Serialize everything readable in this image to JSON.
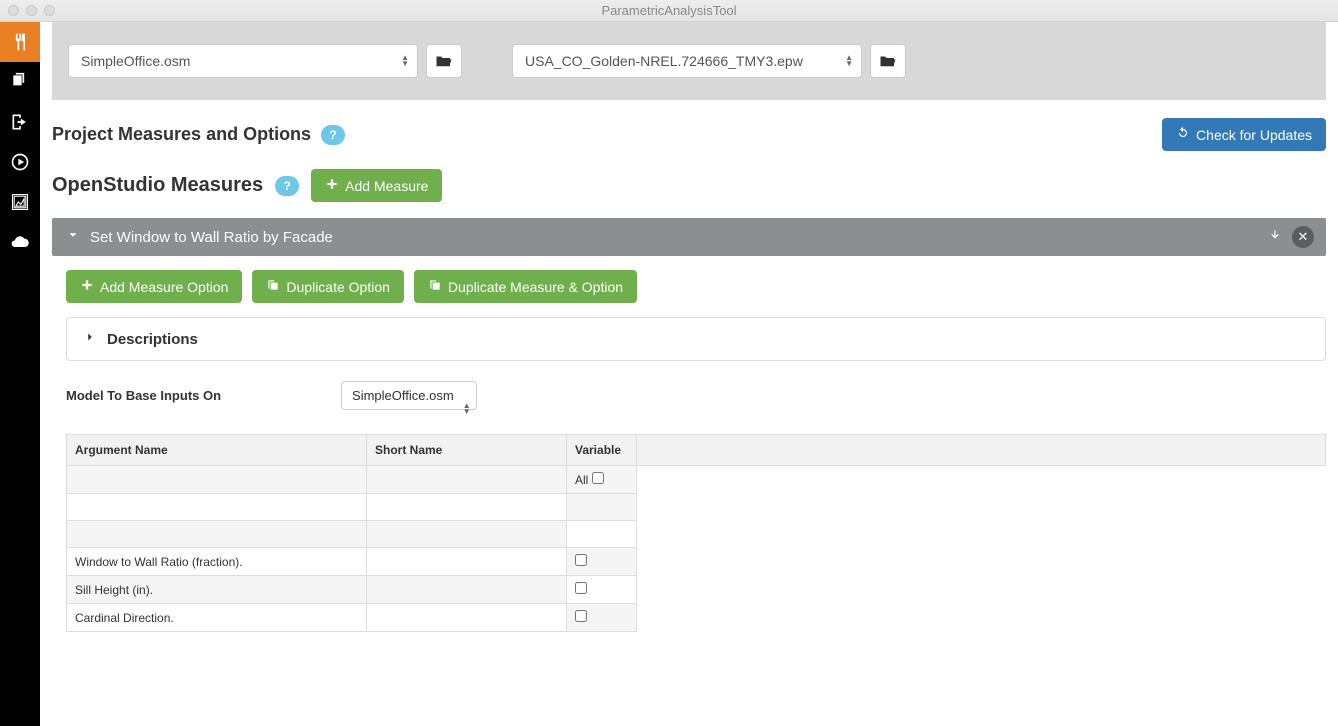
{
  "window": {
    "title": "ParametricAnalysisTool"
  },
  "toolbar": {
    "model_file": "SimpleOffice.osm",
    "weather_file": "USA_CO_Golden-NREL.724666_TMY3.epw"
  },
  "section": {
    "heading": "Project Measures and Options",
    "check_updates": "Check for Updates"
  },
  "openstudio": {
    "heading": "OpenStudio Measures",
    "add_measure": "Add Measure"
  },
  "measure": {
    "title": "Set Window to Wall Ratio by Facade",
    "add_option": "Add Measure Option",
    "duplicate_option": "Duplicate Option",
    "duplicate_both": "Duplicate Measure & Option",
    "descriptions_label": "Descriptions",
    "model_base_label": "Model To Base Inputs On",
    "model_base_value": "SimpleOffice.osm"
  },
  "table": {
    "headers": {
      "arg": "Argument Name",
      "short": "Short Name",
      "var": "Variable"
    },
    "all_label": "All",
    "rows": [
      {
        "arg": "",
        "short": ""
      },
      {
        "arg": "",
        "short": ""
      },
      {
        "arg": "",
        "short": ""
      },
      {
        "arg": "Window to Wall Ratio (fraction).",
        "short": ""
      },
      {
        "arg": "Sill Height (in).",
        "short": ""
      },
      {
        "arg": "Cardinal Direction.",
        "short": ""
      }
    ]
  }
}
